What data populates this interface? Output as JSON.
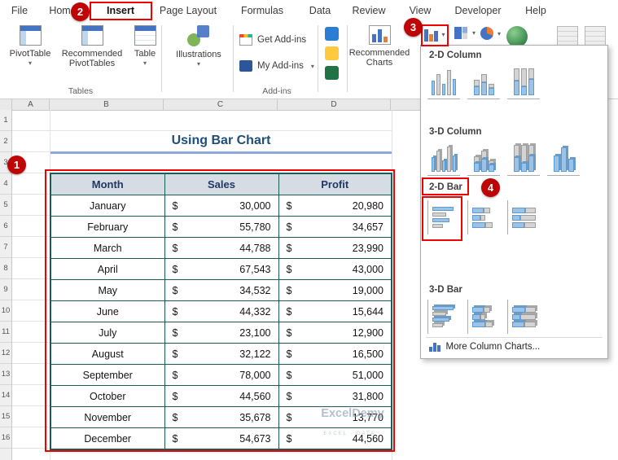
{
  "colors": {
    "callout_red": "#BE0404",
    "box_red": "#F00000",
    "excel_green": "#217346",
    "table_border": "#1D5B57",
    "header_fill": "#D6DCE4",
    "header_text": "#1F3864",
    "title_blue": "#1F4E79",
    "underline_blue": "#8EA9DB",
    "chart_blue": "#9CC3E6",
    "chart_gray": "#D4D4D4"
  },
  "ribbon": {
    "tabs": [
      "File",
      "Home",
      "Insert",
      "Page Layout",
      "Formulas",
      "Data",
      "Review",
      "View",
      "Developer",
      "Help"
    ],
    "tables_group": {
      "pivot": "PivotTable",
      "recommended": "Recommended PivotTables",
      "table": "Table",
      "label": "Tables"
    },
    "illustrations": {
      "label": "Illustrations"
    },
    "addins_group": {
      "get": "Get Add-ins",
      "my": "My Add-ins",
      "label": "Add-ins"
    },
    "charts_group": {
      "recommended": "Recommended Charts"
    }
  },
  "chart_menu": {
    "sections": [
      {
        "title": "2-D Column"
      },
      {
        "title": "3-D Column"
      },
      {
        "title": "2-D Bar"
      },
      {
        "title": "3-D Bar"
      }
    ],
    "footer": "More Column Charts..."
  },
  "callouts": {
    "step1": "1",
    "step2": "2",
    "step3": "3",
    "step4": "4"
  },
  "sheet": {
    "column_letters": [
      "A",
      "B",
      "C",
      "D"
    ],
    "row_numbers": [
      "1",
      "2",
      "3",
      "4",
      "5",
      "6",
      "7",
      "8",
      "9",
      "10",
      "11",
      "12",
      "13",
      "14",
      "15",
      "16"
    ],
    "title": "Using Bar Chart",
    "watermark": {
      "line1": "ExcelDemy",
      "line2": "EXCEL · DATA ·"
    },
    "table": {
      "headers": [
        "Month",
        "Sales",
        "Profit"
      ],
      "currency": "$",
      "rows": [
        {
          "month": "January",
          "sales": "30,000",
          "profit": "20,980"
        },
        {
          "month": "February",
          "sales": "55,780",
          "profit": "34,657"
        },
        {
          "month": "March",
          "sales": "44,788",
          "profit": "23,990"
        },
        {
          "month": "April",
          "sales": "67,543",
          "profit": "43,000"
        },
        {
          "month": "May",
          "sales": "34,532",
          "profit": "19,000"
        },
        {
          "month": "June",
          "sales": "44,332",
          "profit": "15,644"
        },
        {
          "month": "July",
          "sales": "23,100",
          "profit": "12,900"
        },
        {
          "month": "August",
          "sales": "32,122",
          "profit": "16,500"
        },
        {
          "month": "September",
          "sales": "78,000",
          "profit": "51,000"
        },
        {
          "month": "October",
          "sales": "44,560",
          "profit": "31,800"
        },
        {
          "month": "November",
          "sales": "35,678",
          "profit": "13,770"
        },
        {
          "month": "December",
          "sales": "54,673",
          "profit": "44,560"
        }
      ]
    }
  }
}
